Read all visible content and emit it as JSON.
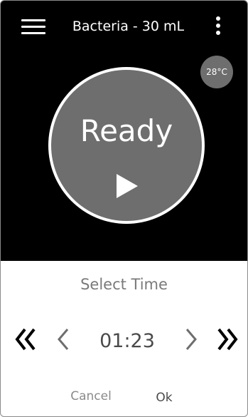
{
  "header": {
    "menu_icon": "hamburger-menu-icon",
    "title": "Bacteria - 30 mL",
    "more_icon": "vertical-dots-icon"
  },
  "status": {
    "temperature": "28°C"
  },
  "main_button": {
    "label": "Ready",
    "icon": "play-icon"
  },
  "time_selector": {
    "label": "Select Time",
    "value": "01:23",
    "icons": [
      "double-chevron-left-icon",
      "chevron-left-icon",
      "chevron-right-icon",
      "double-chevron-right-icon"
    ]
  },
  "actions": {
    "cancel_label": "Cancel",
    "ok_label": "Ok"
  },
  "colors": {
    "top_background": "#000000",
    "circle_fill": "#6e6e6e",
    "bottom_background": "#ffffff",
    "muted_text": "#7a7a7a",
    "dark_text": "#4a4a4a"
  }
}
